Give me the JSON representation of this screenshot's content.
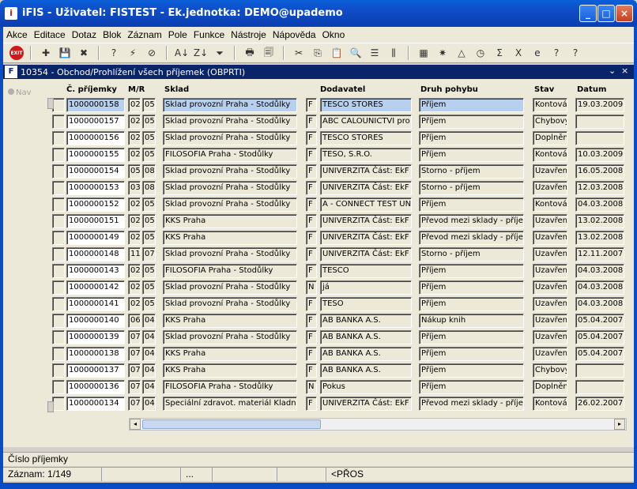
{
  "window": {
    "title": "iFIS - Uživatel: FISTEST - Ek.jednotka: DEMO@upademo",
    "app_icon": "i",
    "minimize": "_",
    "maximize": "□",
    "close": "×"
  },
  "menu": [
    "Akce",
    "Editace",
    "Dotaz",
    "Blok",
    "Záznam",
    "Pole",
    "Funkce",
    "Nástroje",
    "Nápověda",
    "Okno"
  ],
  "toolbar": {
    "exit_label": "EXIT",
    "icons": [
      "add-row-icon",
      "save-icon",
      "delete-icon",
      "query-icon",
      "execute-query-icon",
      "cancel-query-icon",
      "sort-asc-icon",
      "sort-desc-icon",
      "filter-icon",
      "print-icon",
      "print-preview-icon",
      "cut-icon",
      "copy-icon",
      "paste-icon",
      "search-icon",
      "list-icon",
      "columns-icon",
      "calculator-icon",
      "settings-icon",
      "chart-icon",
      "clock-icon",
      "sum-icon",
      "excel-icon",
      "web-icon",
      "help-context-icon",
      "help-icon"
    ],
    "glyphs": [
      "✚",
      "💾",
      "✖",
      "?",
      "⚡",
      "⊘",
      "A↓",
      "Z↓",
      "⏷",
      "🖶",
      "🗐",
      "✂",
      "⎘",
      "📋",
      "🔍",
      "☰",
      "⫼",
      "▦",
      "✷",
      "△",
      "◷",
      "Σ",
      "X",
      "e",
      "?",
      "?"
    ]
  },
  "form": {
    "title": "10354 - Obchod/Prohlížení všech příjemek (OBPRTI)",
    "icon": "F",
    "nav_label": "Nav",
    "controls": [
      "⌄",
      "×"
    ]
  },
  "table": {
    "headers": {
      "cislo": "Č. příjemky",
      "mr": "M/R",
      "sklad": "Sklad",
      "dodavatel": "Dodavatel",
      "druh": "Druh pohybu",
      "stav": "Stav",
      "datum": "Datum"
    },
    "rows": [
      {
        "cislo": "1000000158",
        "m": "02",
        "r": "05",
        "sklad": "Sklad provozní Praha - Stodůlky",
        "typ": "F",
        "dodavatel": "TESCO STORES",
        "druh": "Příjem",
        "stav": "Kontová",
        "datum": "19.03.2009"
      },
      {
        "cislo": "1000000157",
        "m": "02",
        "r": "05",
        "sklad": "Sklad provozní Praha - Stodůlky",
        "typ": "F",
        "dodavatel": "ABC CALOUNICTVI pro",
        "druh": "Příjem",
        "stav": "Chybový",
        "datum": ""
      },
      {
        "cislo": "1000000156",
        "m": "02",
        "r": "05",
        "sklad": "Sklad provozní Praha - Stodůlky",
        "typ": "F",
        "dodavatel": "TESCO STORES",
        "druh": "Příjem",
        "stav": "Doplněn",
        "datum": ""
      },
      {
        "cislo": "1000000155",
        "m": "02",
        "r": "05",
        "sklad": "FILOSOFIA Praha - Stodůlky",
        "typ": "F",
        "dodavatel": "TESO, S.R.O.",
        "druh": "Příjem",
        "stav": "Kontová",
        "datum": "10.03.2009"
      },
      {
        "cislo": "1000000154",
        "m": "05",
        "r": "08",
        "sklad": "Sklad provozní Praha - Stodůlky",
        "typ": "F",
        "dodavatel": "UNIVERZITA Část: EkF",
        "druh": "Storno - příjem",
        "stav": "Uzavřen",
        "datum": "16.05.2008"
      },
      {
        "cislo": "1000000153",
        "m": "03",
        "r": "08",
        "sklad": "Sklad provozní Praha - Stodůlky",
        "typ": "F",
        "dodavatel": "UNIVERZITA Část: EkF",
        "druh": "Storno - příjem",
        "stav": "Uzavřen",
        "datum": "12.03.2008"
      },
      {
        "cislo": "1000000152",
        "m": "02",
        "r": "05",
        "sklad": "Sklad provozní Praha - Stodůlky",
        "typ": "F",
        "dodavatel": "A - CONNECT TEST UN",
        "druh": "Příjem",
        "stav": "Kontová",
        "datum": "04.03.2008"
      },
      {
        "cislo": "1000000151",
        "m": "02",
        "r": "05",
        "sklad": "KKS Praha",
        "typ": "F",
        "dodavatel": "UNIVERZITA Část: EkF",
        "druh": "Převod mezi sklady - příjem",
        "stav": "Uzavřen",
        "datum": "13.02.2008"
      },
      {
        "cislo": "1000000149",
        "m": "02",
        "r": "05",
        "sklad": "KKS Praha",
        "typ": "F",
        "dodavatel": "UNIVERZITA Část: EkF",
        "druh": "Převod mezi sklady - příjem",
        "stav": "Uzavřen",
        "datum": "13.02.2008"
      },
      {
        "cislo": "1000000148",
        "m": "11",
        "r": "07",
        "sklad": "Sklad provozní Praha - Stodůlky",
        "typ": "F",
        "dodavatel": "UNIVERZITA Část: EkF",
        "druh": "Storno - příjem",
        "stav": "Uzavřen",
        "datum": "12.11.2007"
      },
      {
        "cislo": "1000000143",
        "m": "02",
        "r": "05",
        "sklad": "FILOSOFIA Praha - Stodůlky",
        "typ": "F",
        "dodavatel": "TESCO",
        "druh": "Příjem",
        "stav": "Uzavřen",
        "datum": "04.03.2008"
      },
      {
        "cislo": "1000000142",
        "m": "02",
        "r": "05",
        "sklad": "Sklad provozní Praha - Stodůlky",
        "typ": "N",
        "dodavatel": "já",
        "druh": "Příjem",
        "stav": "Uzavřen",
        "datum": "04.03.2008"
      },
      {
        "cislo": "1000000141",
        "m": "02",
        "r": "05",
        "sklad": "Sklad provozní Praha - Stodůlky",
        "typ": "F",
        "dodavatel": " TESO",
        "druh": "Příjem",
        "stav": "Uzavřen",
        "datum": "04.03.2008"
      },
      {
        "cislo": "1000000140",
        "m": "06",
        "r": "04",
        "sklad": "KKS Praha",
        "typ": "F",
        "dodavatel": "AB BANKA A.S.",
        "druh": "Nákup knih",
        "stav": "Uzavřen",
        "datum": "05.04.2007"
      },
      {
        "cislo": "1000000139",
        "m": "07",
        "r": "04",
        "sklad": "Sklad provozní Praha - Stodůlky",
        "typ": "F",
        "dodavatel": "AB BANKA A.S.",
        "druh": "Příjem",
        "stav": "Uzavřen",
        "datum": "05.04.2007"
      },
      {
        "cislo": "1000000138",
        "m": "07",
        "r": "04",
        "sklad": "KKS Praha",
        "typ": "F",
        "dodavatel": "AB BANKA A.S.",
        "druh": "Příjem",
        "stav": "Uzavřen",
        "datum": "05.04.2007"
      },
      {
        "cislo": "1000000137",
        "m": "07",
        "r": "04",
        "sklad": "KKS Praha",
        "typ": "F",
        "dodavatel": "AB BANKA A.S.",
        "druh": "Příjem",
        "stav": "Chybový",
        "datum": ""
      },
      {
        "cislo": "1000000136",
        "m": "07",
        "r": "04",
        "sklad": "FILOSOFIA Praha - Stodůlky",
        "typ": "N",
        "dodavatel": "Pokus",
        "druh": "Příjem",
        "stav": "Doplněn",
        "datum": ""
      },
      {
        "cislo": "1000000134",
        "m": "07",
        "r": "04",
        "sklad": "Speciální zdravot. materiál Kladno",
        "typ": "F",
        "dodavatel": "UNIVERZITA Část: EkF",
        "druh": "Převod mezi sklady - příjem",
        "stav": "Kontová",
        "datum": "26.02.2007"
      }
    ]
  },
  "status": {
    "field_hint": "Číslo příjemky",
    "record": "Záznam: 1/149",
    "dots": "...",
    "mode": "<PŘOS"
  }
}
